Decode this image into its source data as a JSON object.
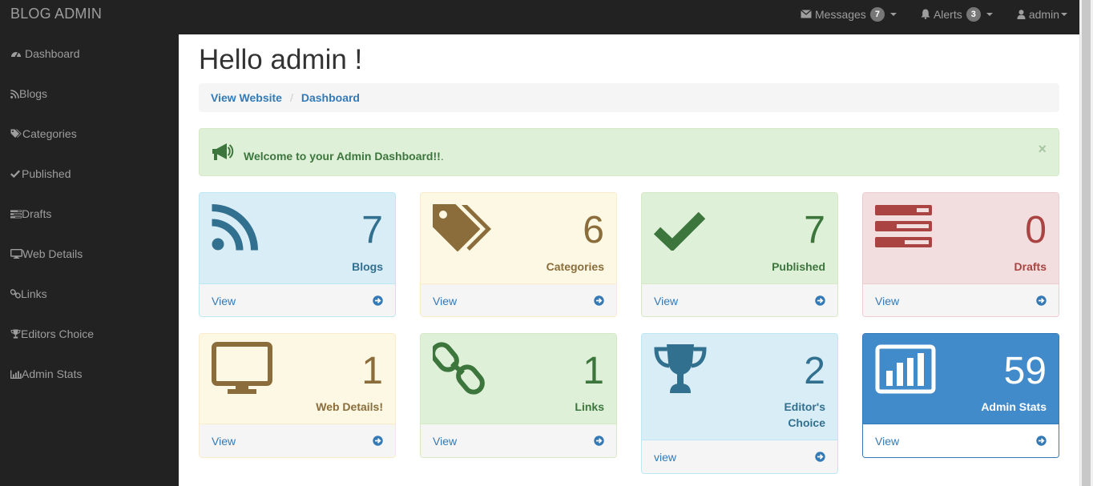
{
  "app": {
    "brand": "BLOG ADMIN"
  },
  "topnav": {
    "messages": {
      "label": "Messages",
      "count": "7"
    },
    "alerts": {
      "label": "Alerts",
      "count": "3"
    },
    "user": {
      "label": "admin"
    }
  },
  "sidebar": {
    "items": [
      {
        "label": "Dashboard",
        "icon": "dashboard-icon"
      },
      {
        "label": "Blogs",
        "icon": "rss-icon"
      },
      {
        "label": "Categories",
        "icon": "tags-icon"
      },
      {
        "label": "Published",
        "icon": "check-icon"
      },
      {
        "label": "Drafts",
        "icon": "list-icon"
      },
      {
        "label": "Web Details",
        "icon": "desktop-icon"
      },
      {
        "label": "Links",
        "icon": "link-icon"
      },
      {
        "label": "Editors Choice",
        "icon": "trophy-icon"
      },
      {
        "label": "Admin Stats",
        "icon": "bar-chart-icon"
      }
    ]
  },
  "main": {
    "title": "Hello admin !",
    "breadcrumb": [
      "View Website",
      "Dashboard"
    ],
    "alert": {
      "message": "Welcome to your Admin Dashboard!!",
      "suffix": ".",
      "close": "×"
    }
  },
  "panels": [
    {
      "count": "7",
      "label": "Blogs",
      "view": "View",
      "icon": "rss-icon",
      "style": "info"
    },
    {
      "count": "6",
      "label": "Categories",
      "view": "View",
      "icon": "tags-icon",
      "style": "warning"
    },
    {
      "count": "7",
      "label": "Published",
      "view": "View",
      "icon": "check-icon",
      "style": "success"
    },
    {
      "count": "0",
      "label": "Drafts",
      "view": "View",
      "icon": "list-icon",
      "style": "danger"
    },
    {
      "count": "1",
      "label": "Web Details!",
      "view": "View",
      "icon": "desktop-icon",
      "style": "warning"
    },
    {
      "count": "1",
      "label": "Links",
      "view": "View",
      "icon": "link-icon",
      "style": "success"
    },
    {
      "count": "2",
      "label_line1": "Editor's",
      "label_line2": "Choice",
      "view": "view",
      "icon": "trophy-icon",
      "style": "info"
    },
    {
      "count": "59",
      "label": "Admin Stats",
      "view": "View",
      "icon": "bar-chart-icon",
      "style": "primary"
    }
  ],
  "colors": {
    "navbar": "#222222",
    "link": "#337ab7",
    "info": "#31708f",
    "warning": "#8a6d3b",
    "success": "#3c763d",
    "danger": "#a94442",
    "primary": "#428bca"
  }
}
